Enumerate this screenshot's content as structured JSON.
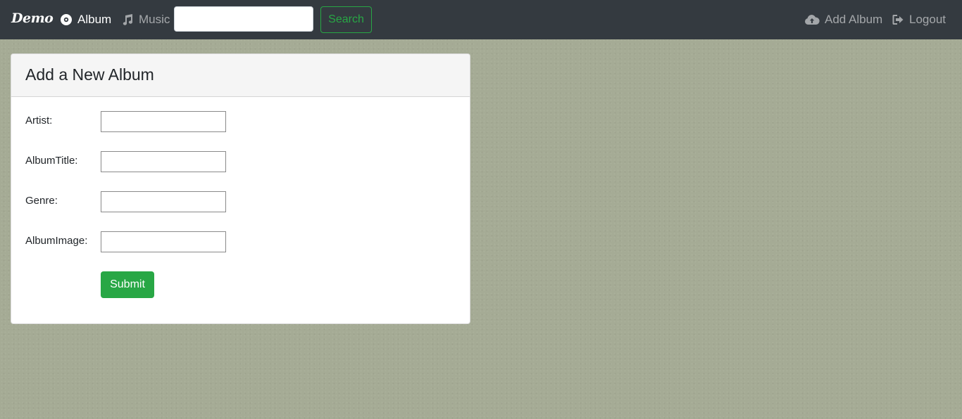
{
  "navbar": {
    "brand": "Demo",
    "links": {
      "album": {
        "label": "Album",
        "icon": "disc-icon"
      },
      "music": {
        "label": "Music",
        "icon": "music-note-icon"
      },
      "add_album": {
        "label": "Add Album",
        "icon": "cloud-upload-icon"
      },
      "logout": {
        "label": "Logout",
        "icon": "sign-out-icon"
      }
    },
    "search": {
      "value": "",
      "placeholder": "",
      "button_label": "Search"
    }
  },
  "card": {
    "title": "Add a New Album",
    "fields": [
      {
        "label": "Artist:",
        "value": ""
      },
      {
        "label": "AlbumTitle:",
        "value": ""
      },
      {
        "label": "Genre:",
        "value": ""
      },
      {
        "label": "AlbumImage:",
        "value": ""
      }
    ],
    "submit_label": "Submit"
  },
  "colors": {
    "navbar_bg": "#343a40",
    "page_bg": "#a5ab95",
    "success": "#28a745"
  }
}
